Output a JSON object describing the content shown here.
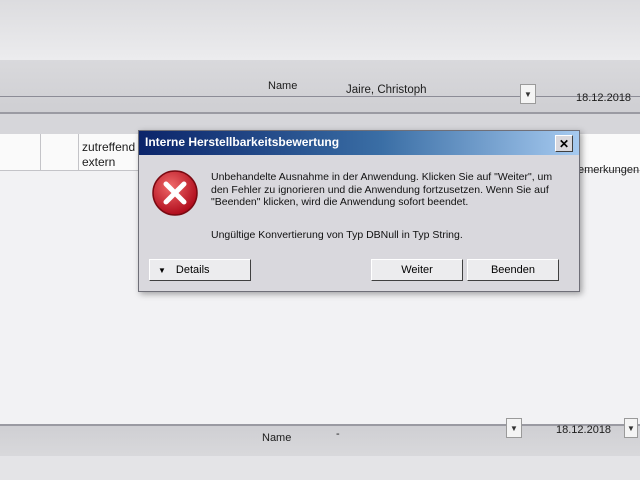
{
  "header": {
    "name_label": "Name",
    "name_value": "Jaire, Christoph",
    "date": "18.12.2018"
  },
  "row": {
    "col1_line1": "zutreffend",
    "col1_line2": "extern",
    "col_right": "emerkungen fü"
  },
  "footer": {
    "name_label": "Name",
    "name_value": "-",
    "date": "18.12.2018"
  },
  "dialog": {
    "title": "Interne Herstellbarkeitsbewertung",
    "close_glyph": "✕",
    "message": "Unbehandelte Ausnahme in der Anwendung. Klicken Sie auf \"Weiter\", um den Fehler zu ignorieren und die Anwendung fortzusetzen. Wenn Sie auf \"Beenden\" klicken, wird die Anwendung sofort beendet.",
    "detail": "Ungültige Konvertierung von Typ DBNull in Typ String.",
    "buttons": {
      "details": "Details",
      "details_glyph": "▼",
      "weiter": "Weiter",
      "beenden": "Beenden"
    },
    "icon": "error-icon"
  },
  "dropdown_glyph": "▼",
  "colors": {
    "title_start": "#0b246a",
    "title_end": "#a6caf0",
    "error_red": "#c8102e"
  }
}
